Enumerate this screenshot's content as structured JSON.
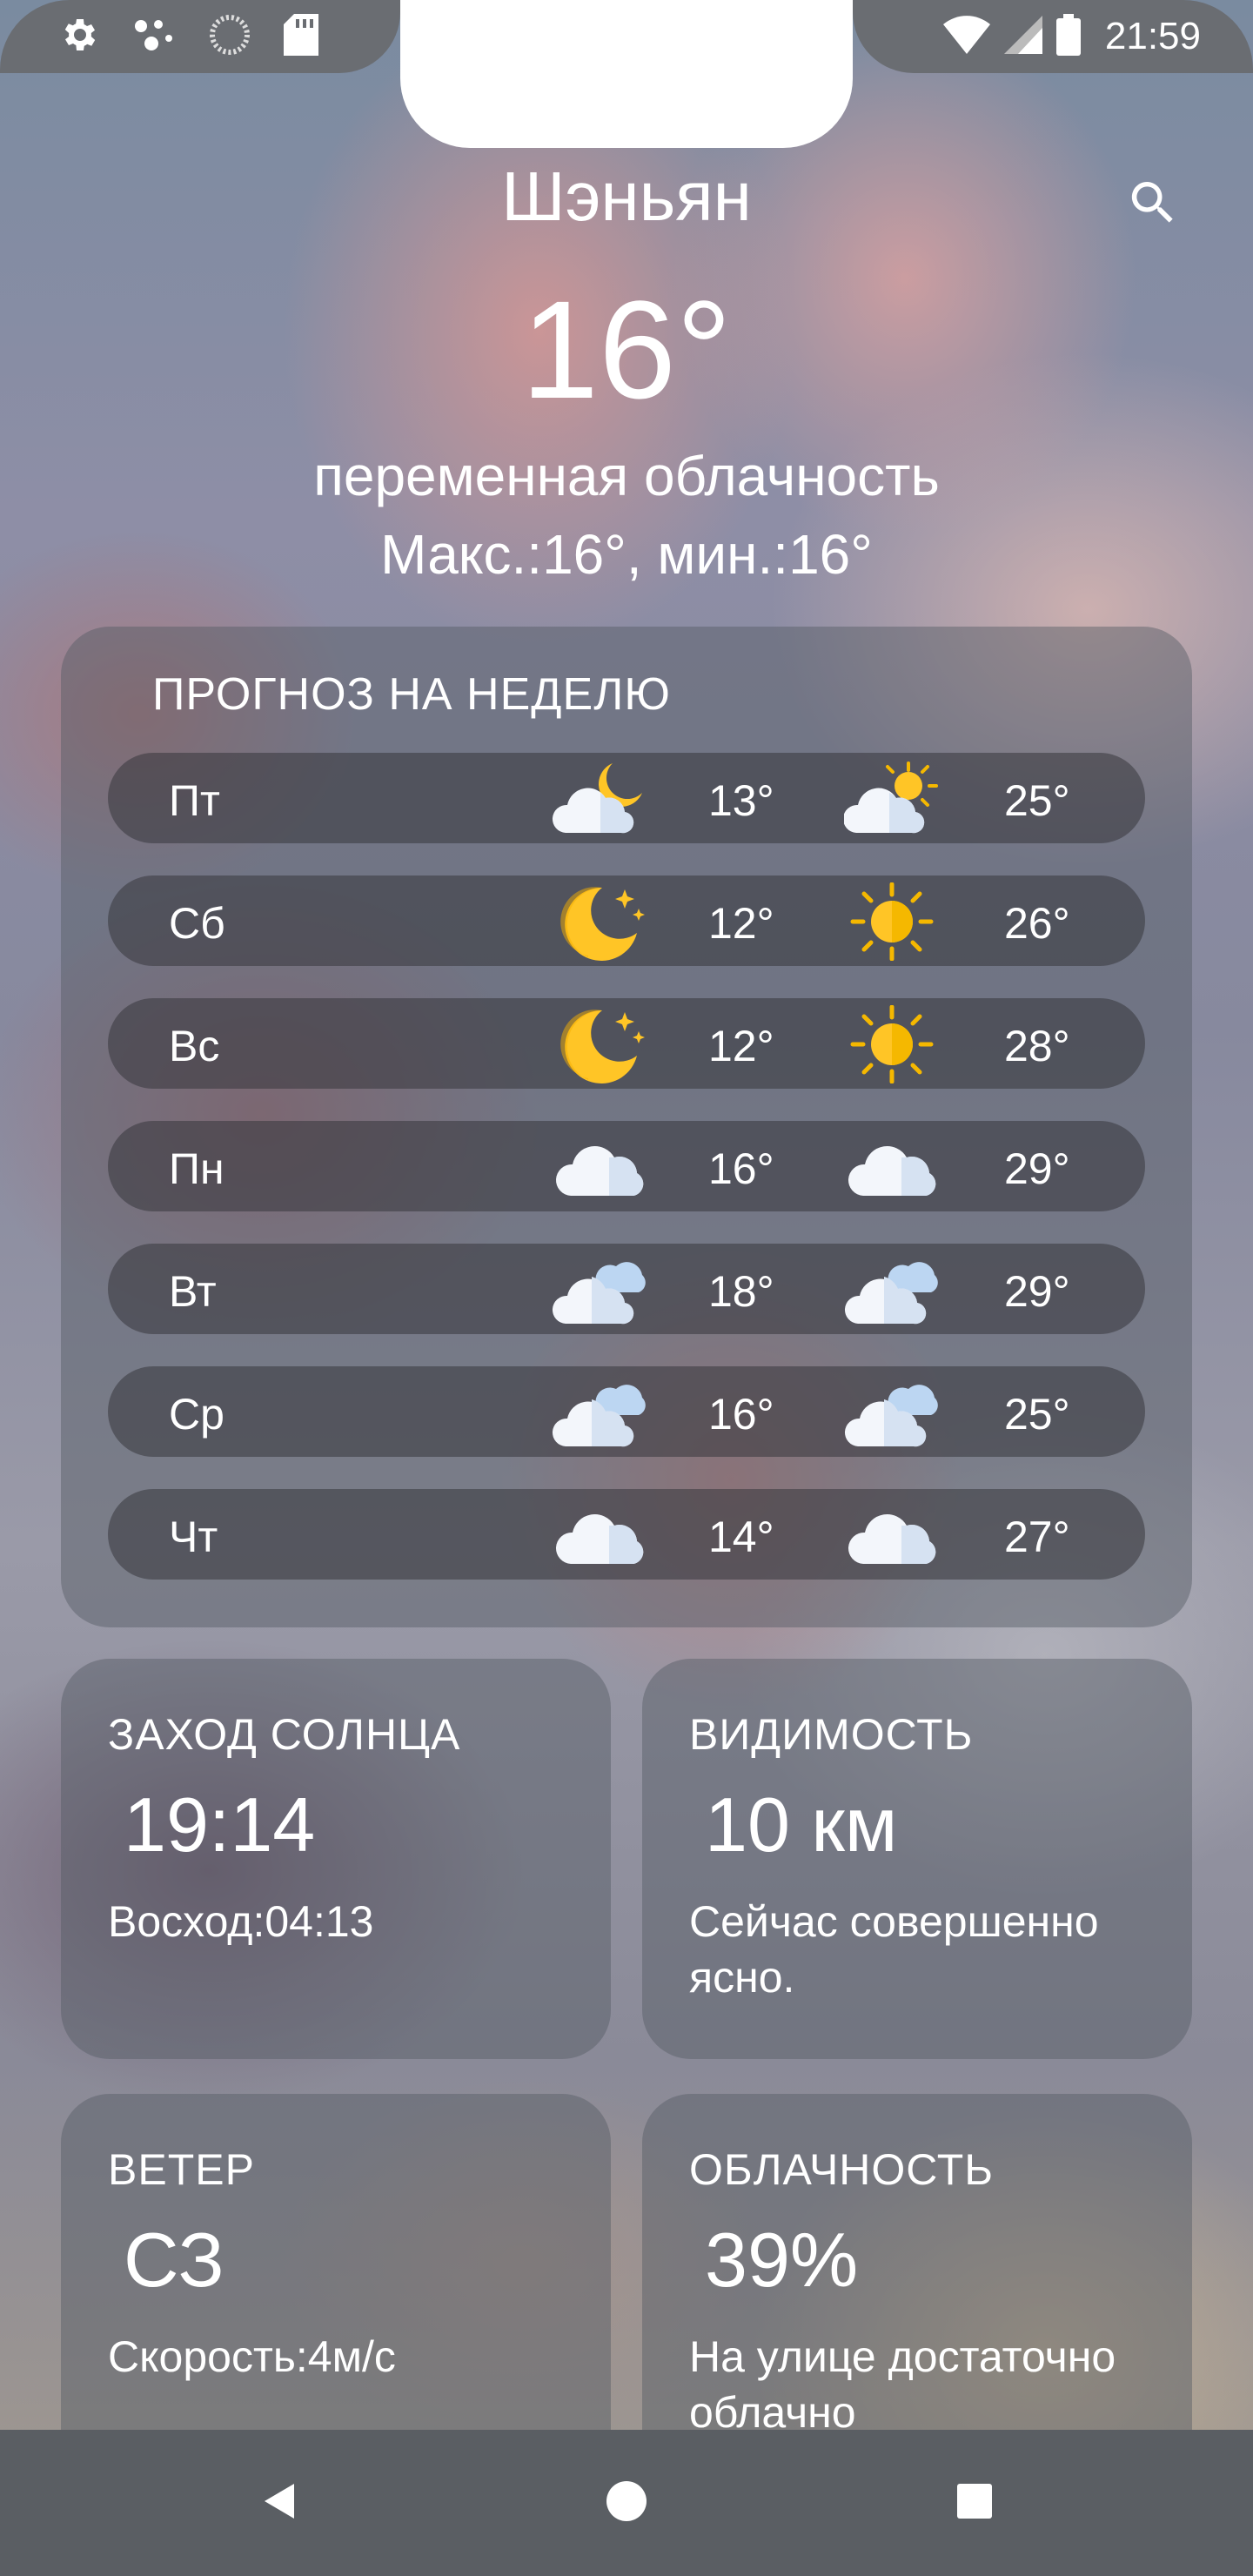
{
  "status_bar": {
    "time": "21:59",
    "left_icons": [
      "gear-icon",
      "assistant-dots-icon",
      "loading-circle-icon",
      "sd-card-icon"
    ],
    "right_icons": [
      "wifi-icon",
      "signal-icon",
      "battery-icon"
    ]
  },
  "header": {
    "city": "Шэньян",
    "temperature": "16°",
    "description": "переменная облачность",
    "minmax": "Макс.:16°, мин.:16°"
  },
  "forecast": {
    "title": "ПРОГНОЗ НА НЕДЕЛЮ",
    "days": [
      {
        "day": "Пт",
        "night_icon": "cloud-moon-icon",
        "night_temp": "13°",
        "day_icon": "cloud-sun-icon",
        "day_temp": "25°"
      },
      {
        "day": "Сб",
        "night_icon": "moon-star-icon",
        "night_temp": "12°",
        "day_icon": "sun-icon",
        "day_temp": "26°"
      },
      {
        "day": "Вс",
        "night_icon": "moon-star-icon",
        "night_temp": "12°",
        "day_icon": "sun-icon",
        "day_temp": "28°"
      },
      {
        "day": "Пн",
        "night_icon": "cloud-icon",
        "night_temp": "16°",
        "day_icon": "cloud-icon",
        "day_temp": "29°"
      },
      {
        "day": "Вт",
        "night_icon": "clouds-icon",
        "night_temp": "18°",
        "day_icon": "clouds-icon",
        "day_temp": "29°"
      },
      {
        "day": "Ср",
        "night_icon": "clouds-icon",
        "night_temp": "16°",
        "day_icon": "clouds-icon",
        "day_temp": "25°"
      },
      {
        "day": "Чт",
        "night_icon": "cloud-icon",
        "night_temp": "14°",
        "day_icon": "cloud-icon",
        "day_temp": "27°"
      }
    ]
  },
  "cards": {
    "sunset": {
      "label": "ЗАХОД СОЛНЦА",
      "value": "19:14",
      "sub": "Восход:04:13"
    },
    "visibility": {
      "label": "ВИДИМОСТЬ",
      "value": "10 км",
      "sub": "Сейчас совершенно ясно."
    },
    "wind": {
      "label": "ВЕТЕР",
      "value": "СЗ",
      "sub": "Скорость:4м/с"
    },
    "clouds": {
      "label": "ОБЛАЧНОСТЬ",
      "value": "39%",
      "sub": "На улице достаточно облачно"
    }
  },
  "nav": {
    "icons": [
      "back-icon",
      "home-icon",
      "recents-icon"
    ]
  }
}
